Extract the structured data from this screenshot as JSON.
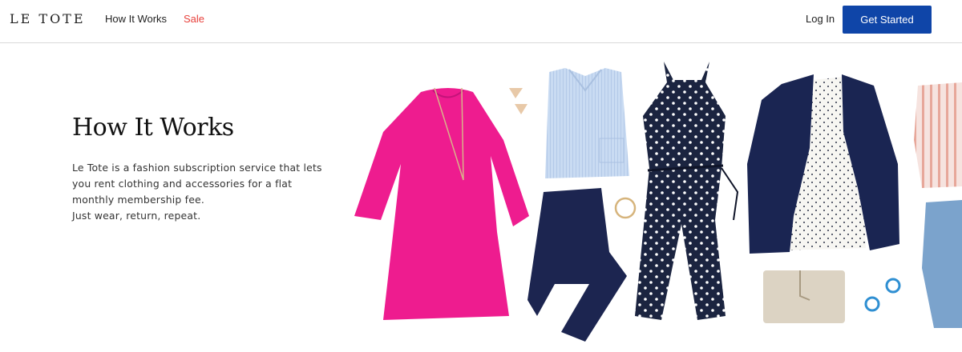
{
  "header": {
    "logo": "LE TOTE",
    "nav": {
      "how_it_works": "How It Works",
      "sale": "Sale"
    },
    "login": "Log In",
    "cta": "Get Started"
  },
  "colors": {
    "brand_blue": "#0f45a8",
    "sale_red": "#e8413c"
  },
  "hero": {
    "title": "How It Works",
    "description": "Le Tote is a fashion subscription service that lets you rent clothing and accessories for a flat monthly membership fee.",
    "tagline": "Just wear, return, repeat."
  },
  "illustration": {
    "items": [
      "pink-dress",
      "light-blue-shirt",
      "navy-trousers",
      "polka-dot-jumpsuit",
      "navy-blazer",
      "white-dotted-top",
      "beige-clutch",
      "tassel-earrings",
      "blue-earrings",
      "bracelet",
      "striped-blouse",
      "denim-jeans"
    ]
  }
}
